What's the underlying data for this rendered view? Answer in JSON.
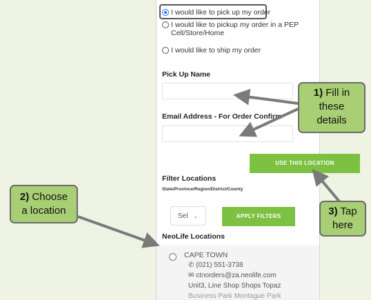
{
  "shipping_options": [
    {
      "label": "I would like to pick up my order",
      "selected": true
    },
    {
      "label_line1": "I would like to pickup my order in a PEP",
      "label_line2": "Cell/Store/Home",
      "selected": false
    },
    {
      "label": "I would like to ship my order",
      "selected": false
    }
  ],
  "form": {
    "pickup_name_label": "Pick Up Name",
    "email_label": "Email Address - For Order Confirm"
  },
  "use_location_button": "USE THIS LOCATION",
  "filter": {
    "title": "Filter Locations",
    "subtitle": "State/Province/Region/District/County",
    "select_value": "Sel",
    "apply_button": "APPLY FILTERS"
  },
  "locations": {
    "title": "NeoLife Locations",
    "items": [
      {
        "name": "CAPE TOWN",
        "phone": "(021) 551-3738",
        "email": "ctnorders@za.neolife.com",
        "address": "Unit3, Line Shop Shops Topaz",
        "address_cut": "Business Park Montague Park"
      }
    ]
  },
  "callouts": {
    "step1": {
      "num": "1)",
      "line1": "Fill in",
      "line2": "these",
      "line3": "details"
    },
    "step2": {
      "num": "2)",
      "line1": "Choose",
      "line2": "a location"
    },
    "step3": {
      "num": "3)",
      "line1": "Tap",
      "line2": "here"
    }
  },
  "colors": {
    "accent_green": "#7cc141",
    "callout_green": "#a8cf74",
    "radio_blue": "#1a73e8"
  }
}
